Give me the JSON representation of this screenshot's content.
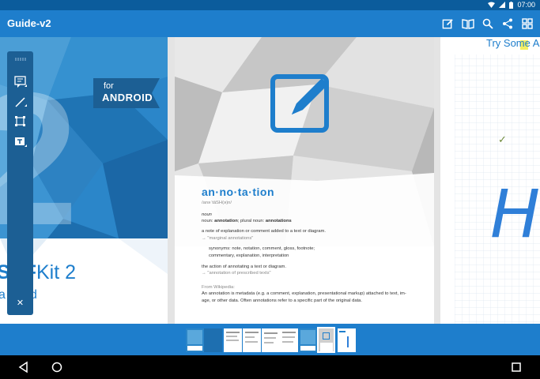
{
  "status": {
    "time": "07:00"
  },
  "app_bar": {
    "title": "Guide-v2",
    "actions": [
      "edit-icon",
      "book-icon",
      "search-icon",
      "share-icon",
      "grid-icon"
    ]
  },
  "cover": {
    "platform_for": "for",
    "platform_name": "ANDROID",
    "big_number": "2",
    "brand_a": "SDF",
    "brand_b": "Kit 2",
    "tagline": "a",
    "tagline2": "ound"
  },
  "definition": {
    "word": "an·no·ta·tion",
    "pron": "/anəˈtāSH(ə)n/",
    "pos": "noun",
    "forms_lead": "noun: ",
    "forms_1": "annotation",
    "forms_mid": "; plural noun: ",
    "forms_2": "annotations",
    "sense1": "a note of explanation or comment added to a text or diagram.",
    "example1": "\"marginal annotations\"",
    "synonyms_line1": "synonyms: note, notation, comment, gloss, footnote;",
    "synonyms_line2": "commentary, explanation, interpretation",
    "sense2": "the action of annotating a text or diagram.",
    "example2": "\"annotation of prescribed texts\"",
    "source": "From Wikipedia:",
    "wiki_line1": "An annotation is metadata (e.g. a comment, explanation, presentational markup) attached to text, im-",
    "wiki_line2": "age, or other data. Often annotations refer to a specific part of the original data."
  },
  "sketch": {
    "heading": "Try Some A",
    "handwriting": "Ho",
    "check": "✓"
  },
  "toolbar": {
    "tools": [
      "note-annotation-icon",
      "line-icon",
      "shape-icon",
      "text-icon"
    ],
    "close": "✕"
  },
  "thumbnails": {
    "count": 9,
    "selected": 7
  },
  "colors": {
    "primary": "#1e7ecc",
    "dark": "#0b5c9c",
    "toolbar": "#1c5f94"
  }
}
